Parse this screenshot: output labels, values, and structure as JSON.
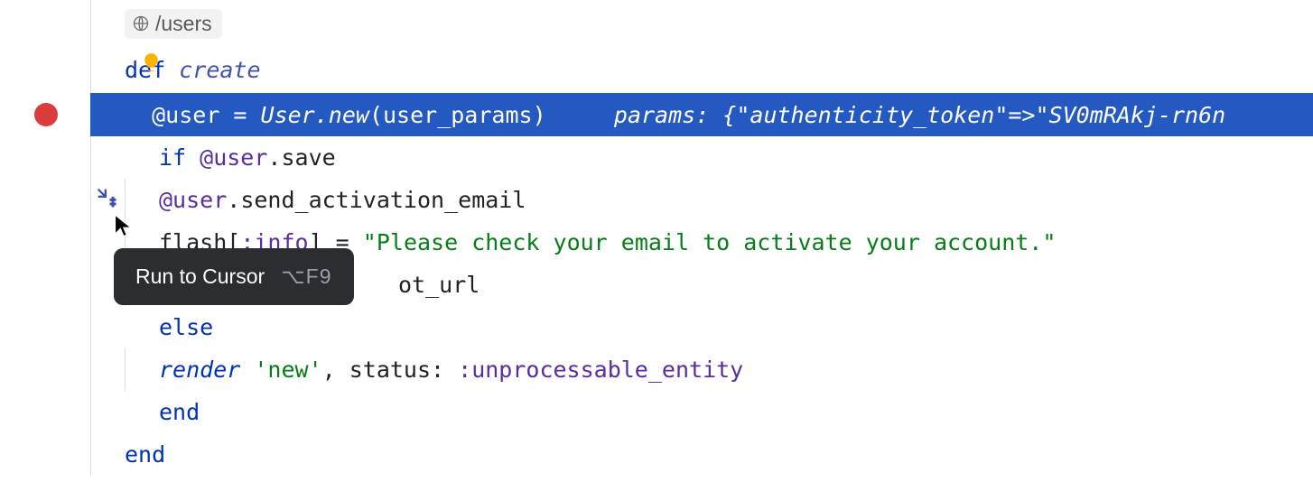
{
  "route_hint": "/users",
  "tooltip": {
    "label": "Run to Cursor",
    "shortcut": "⌥F9"
  },
  "debug_inline": "params: {\"authenticity_token\"=>\"SV0mRAkj-rn6n",
  "code": {
    "def": "def ",
    "method_name": "create",
    "l_assign": "@user = ",
    "l_classnew": "User.new",
    "l_params": "(user_params)",
    "if": "if ",
    "if_var": "@user",
    "save": ".save",
    "sendact_var": "@user",
    "sendact": ".send_activation_email",
    "flash_pre": "flash[",
    "flash_sym": ":info",
    "flash_post": "] = ",
    "flash_str": "\"Please check your email to activate your account.\"",
    "redir_tail": "ot_url",
    "else": "else",
    "render": "render ",
    "render_str": "'new'",
    "render_rest": ", status: ",
    "render_sym": ":unprocessable_entity",
    "end": "end"
  }
}
